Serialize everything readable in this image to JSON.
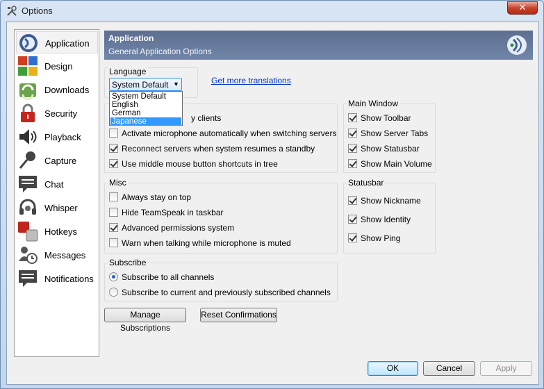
{
  "window": {
    "title": "Options",
    "close_glyph": "✕"
  },
  "sidebar": {
    "items": [
      {
        "label": "Application",
        "icon": "application-icon"
      },
      {
        "label": "Design",
        "icon": "design-icon"
      },
      {
        "label": "Downloads",
        "icon": "downloads-icon"
      },
      {
        "label": "Security",
        "icon": "security-icon"
      },
      {
        "label": "Playback",
        "icon": "playback-icon"
      },
      {
        "label": "Capture",
        "icon": "capture-icon"
      },
      {
        "label": "Chat",
        "icon": "chat-icon"
      },
      {
        "label": "Whisper",
        "icon": "whisper-icon"
      },
      {
        "label": "Hotkeys",
        "icon": "hotkeys-icon"
      },
      {
        "label": "Messages",
        "icon": "messages-icon"
      },
      {
        "label": "Notifications",
        "icon": "notifications-icon"
      }
    ],
    "active_index": 0
  },
  "header": {
    "title": "Application",
    "subtitle": "General Application Options"
  },
  "language": {
    "group_title": "Language",
    "selected": "System Default",
    "options": [
      "System Default",
      "English",
      "German",
      "Japanese"
    ],
    "highlighted": "Japanese",
    "more_link": "Get more translations"
  },
  "general": {
    "partial_label": "y clients",
    "items": [
      {
        "label": "Activate microphone automatically when switching servers",
        "checked": false
      },
      {
        "label": "Reconnect servers when system resumes a standby",
        "checked": true
      },
      {
        "label": "Use middle mouse button shortcuts in tree",
        "checked": true
      }
    ]
  },
  "main_window": {
    "group_title": "Main Window",
    "items": [
      {
        "label": "Show Toolbar",
        "checked": true
      },
      {
        "label": "Show Server Tabs",
        "checked": true
      },
      {
        "label": "Show Statusbar",
        "checked": true
      },
      {
        "label": "Show Main Volume",
        "checked": true
      }
    ]
  },
  "misc": {
    "group_title": "Misc",
    "items": [
      {
        "label": "Always stay on top",
        "checked": false
      },
      {
        "label": "Hide TeamSpeak in taskbar",
        "checked": false
      },
      {
        "label": "Advanced permissions system",
        "checked": true
      },
      {
        "label": "Warn when talking while microphone is muted",
        "checked": false
      }
    ]
  },
  "statusbar": {
    "group_title": "Statusbar",
    "items": [
      {
        "label": "Show Nickname",
        "checked": true
      },
      {
        "label": "Show Identity",
        "checked": true
      },
      {
        "label": "Show Ping",
        "checked": true
      }
    ]
  },
  "subscribe": {
    "group_title": "Subscribe",
    "options": [
      {
        "label": "Subscribe to all channels",
        "selected": true
      },
      {
        "label": "Subscribe to current and previously subscribed channels",
        "selected": false
      }
    ]
  },
  "actions": {
    "manage_subscriptions": "Manage Subscriptions",
    "reset_confirmations": "Reset Confirmations"
  },
  "footer": {
    "ok": "OK",
    "cancel": "Cancel",
    "apply": "Apply"
  }
}
